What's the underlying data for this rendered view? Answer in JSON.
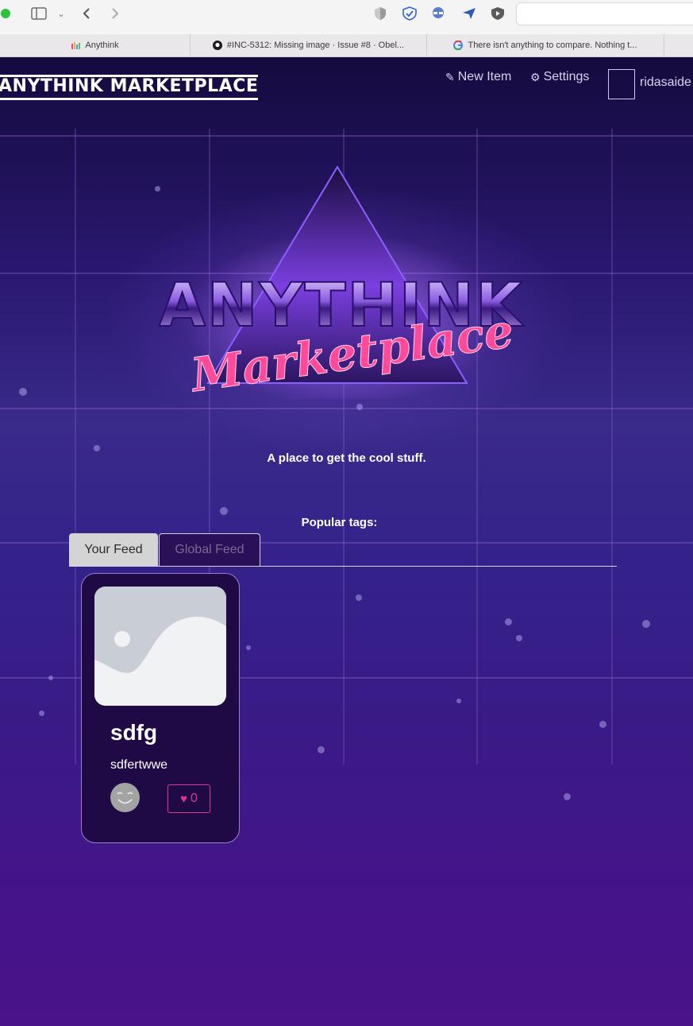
{
  "browser": {
    "tabs": [
      {
        "title": "Anythink"
      },
      {
        "title": "#INC-5312: Missing image · Issue #8 · Obel..."
      },
      {
        "title": "There isn't anything to compare. Nothing t..."
      }
    ]
  },
  "header": {
    "brand": "ANYTHINK MARKETPLACE",
    "new_item": "New Item",
    "settings": "Settings",
    "username": "ridasaide"
  },
  "hero": {
    "logo_line1": "ANYTHINK",
    "logo_line2": "Marketplace",
    "tagline": "A place to get the cool stuff."
  },
  "tags": {
    "title": "Popular tags:"
  },
  "feed": {
    "tabs": [
      "Your Feed",
      "Global Feed"
    ],
    "items": [
      {
        "title": "sdfg",
        "description": "sdfertwwe",
        "favorites": "0"
      }
    ]
  },
  "colors": {
    "accent_pink": "#e0368e",
    "card_bg": "#1f0a45",
    "card_border": "#9a7fcf"
  }
}
